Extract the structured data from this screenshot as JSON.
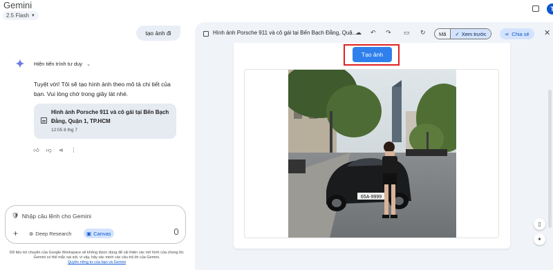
{
  "app": {
    "title": "Gemini",
    "model": "2.5 Flash"
  },
  "chat": {
    "user_message": "tạo ảnh đi",
    "thinking_label": "Hiện tiến trình tư duy",
    "reply_text": "Tuyệt vời! Tôi sẽ tạo hình ảnh theo mô tả chi tiết của bạn. Vui lòng chờ trong giây lát nhé.",
    "doc_card": {
      "title": "Hình ảnh Porsche 911 và cô gái tại Bến Bạch Đằng, Quận 1, TP.HCM",
      "time": "12:05 8 thg 7"
    }
  },
  "composer": {
    "placeholder": "Nhập câu lệnh cho Gemini",
    "tools": {
      "deep_research": "Deep Research",
      "canvas": "Canvas"
    }
  },
  "disclaimer": {
    "text": "Dữ liệu trò chuyện của Google Workspace sẽ không được dùng để cải thiện các mô hình của chúng tôi. Gemini có thể mắc sai sót, vì vậy, hãy xác minh các câu trả lời của Gemini.",
    "link": "Quyền riêng tư của bạn và Gemini"
  },
  "canvas": {
    "title": "Hình ảnh Porsche 911 và cô gái tại Bến Bạch Đằng, Quậ...",
    "code_label": "Mã",
    "preview_label": "Xem trước",
    "share_label": "Chia sẻ",
    "generate_button": "Tạo ảnh",
    "plate_text": "65A-9999"
  },
  "user": {
    "avatar_initial": "T"
  },
  "colors": {
    "accent": "#0b57d0",
    "generate_button": "#2f80ed",
    "highlight": "#e02020"
  }
}
